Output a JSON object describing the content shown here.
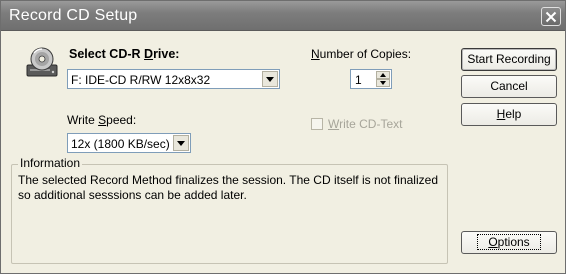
{
  "window": {
    "title": "Record CD Setup"
  },
  "drive": {
    "label_pre": "Select CD-R ",
    "label_accel": "D",
    "label_post": "rive:",
    "selected": "F: IDE-CD R/RW 12x8x32"
  },
  "speed": {
    "label_pre": "Write ",
    "label_accel": "S",
    "label_post": "peed:",
    "selected": "12x (1800 KB/sec)"
  },
  "copies": {
    "label_accel": "N",
    "label_post": "umber of Copies:",
    "value": "1"
  },
  "cdtext": {
    "label_accel": "W",
    "label_post": "rite CD-Text",
    "checked": false,
    "enabled": false
  },
  "buttons": {
    "start_recording": "Start Recording",
    "cancel": "Cancel",
    "help_accel": "H",
    "help_post": "elp",
    "options_accel": "O",
    "options_post": "ptions"
  },
  "information": {
    "legend": "Information",
    "text": "The selected Record Method finalizes the session. The CD itself is not finalized so additional sesssions can be added later."
  },
  "icons": {
    "close": "close-icon",
    "drive": "cd-drive-icon",
    "dropdown": "chevron-down-icon",
    "spin_up": "spin-up-icon",
    "spin_down": "spin-down-icon"
  }
}
